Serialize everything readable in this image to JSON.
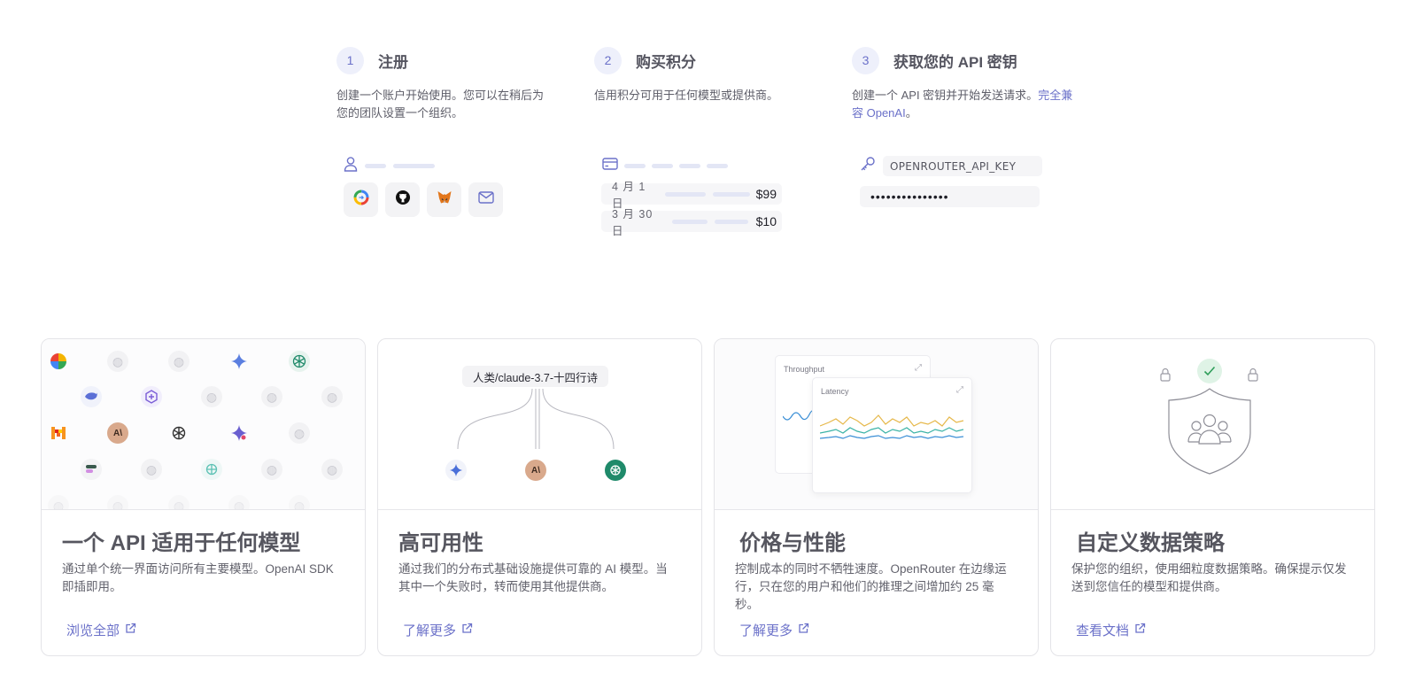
{
  "steps": [
    {
      "number": "1",
      "title": "注册",
      "description": "创建一个账户开始使用。您可以在稍后为您的团队设置一个组织。"
    },
    {
      "number": "2",
      "title": "购买积分",
      "description": "信用积分可用于任何模型或提供商。"
    },
    {
      "number": "3",
      "title": "获取您的 API 密钥",
      "description": "创建一个 API 密钥并开始发送请求。",
      "description_accent": "完全兼容 OpenAI",
      "description_end": "。"
    }
  ],
  "signup_visual": {
    "icons": [
      "user-icon",
      "google-icon",
      "github-icon",
      "metamask-icon",
      "mail-icon"
    ]
  },
  "credits_visual": {
    "icon": "credit-card-icon",
    "transactions": [
      {
        "date": "4 月 1 日",
        "amount": "$99"
      },
      {
        "date": "3 月 30 日",
        "amount": "$10"
      }
    ]
  },
  "apikey_visual": {
    "icon": "key-icon",
    "key_name": "OPENROUTER_API_KEY",
    "key_value": "•••••••••••••••"
  },
  "features": [
    {
      "title": "一个 API 适用于任何模型",
      "description": "通过单个统一界面访问所有主要模型。OpenAI SDK 即插即用。",
      "link": "浏览全部"
    },
    {
      "title": "高可用性",
      "description": "通过我们的分布式基础设施提供可靠的 AI 模型。当其中一个失败时，转而使用其他提供商。",
      "link": "了解更多"
    },
    {
      "title": "价格与性能",
      "description": "控制成本的同时不牺牲速度。OpenRouter 在边缘运行，只在您的用户和他们的推理之间增加约 25 毫秒。",
      "link": "了解更多"
    },
    {
      "title": "自定义数据策略",
      "description": "保护您的组织，使用细粒度数据策略。确保提示仅发送到您信任的模型和提供商。",
      "link": "查看文档"
    }
  ],
  "availability_visual": {
    "model_label": "人类/claude-3.7-十四行诗"
  },
  "performance_visual": {
    "throughput_label": "Throughput",
    "latency_label": "Latency"
  },
  "colors": {
    "accent": "#6b71c9",
    "text": "#56565f",
    "border": "#e4e4e8",
    "latency_yellow": "#e6b84a",
    "latency_teal": "#3bb3a6",
    "latency_blue": "#3b8fd6"
  }
}
